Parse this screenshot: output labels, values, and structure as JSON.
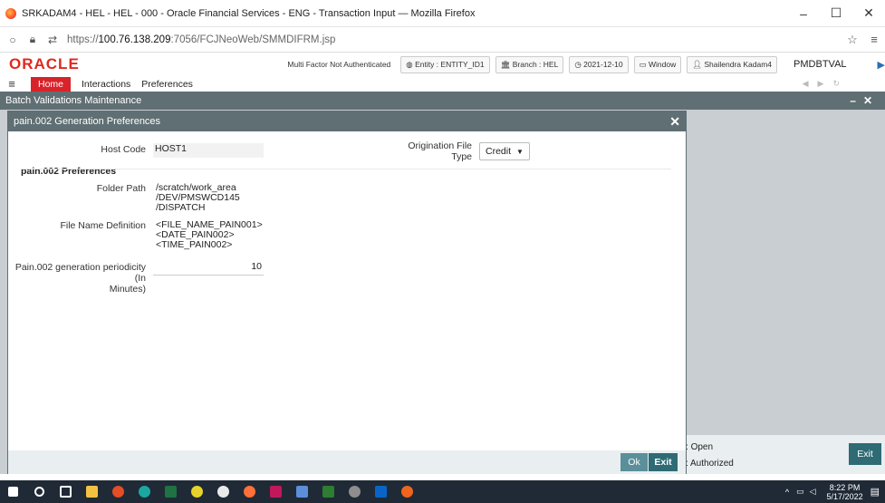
{
  "browser": {
    "title": "SRKADAM4 - HEL - HEL - 000 - Oracle Financial Services - ENG - Transaction Input — Mozilla Firefox",
    "url_prefix": "https://",
    "url_host": "100.76.138.209",
    "url_rest": ":7056/FCJNeoWeb/SMMDIFRM.jsp",
    "minimize": "–",
    "maximize": "☐",
    "close": "✕"
  },
  "header": {
    "logo": "ORACLE",
    "mfa": "Multi Factor Not Authenticated",
    "entity": "Entity : ENTITY_ID1",
    "branch": "Branch : HEL",
    "date": "2021-12-10",
    "window": "Window",
    "user": "Shailendra Kadam4",
    "server": "PMDBTVAL"
  },
  "menu": {
    "home": "Home",
    "interactions": "Interactions",
    "preferences": "Preferences"
  },
  "background_window": {
    "title": "Batch Validations Maintenance",
    "status_open": "Open",
    "status_authorized": "Authorized",
    "exit": "Exit"
  },
  "modal": {
    "title": "pain.002 Generation Preferences",
    "host_code_label": "Host Code",
    "host_code_value": "HOST1",
    "origination_label": "Origination File Type",
    "origination_value": "Credit",
    "section_title": "pain.002 Preferences",
    "folder_path_label": "Folder Path",
    "folder_path_lines": [
      "/scratch/work_area",
      "/DEV/PMSWCD145",
      "/DISPATCH"
    ],
    "file_name_label": "File Name Definition",
    "file_name_lines": [
      "<FILE_NAME_PAIN001>",
      "<DATE_PAIN002>",
      "<TIME_PAIN002>"
    ],
    "periodicity_label_1": "Pain.002 generation periodicity (In",
    "periodicity_label_2": "Minutes)",
    "periodicity_value": "10",
    "ok": "Ok",
    "exit": "Exit"
  },
  "taskbar": {
    "time": "8:22 PM",
    "date": "5/17/2022"
  }
}
